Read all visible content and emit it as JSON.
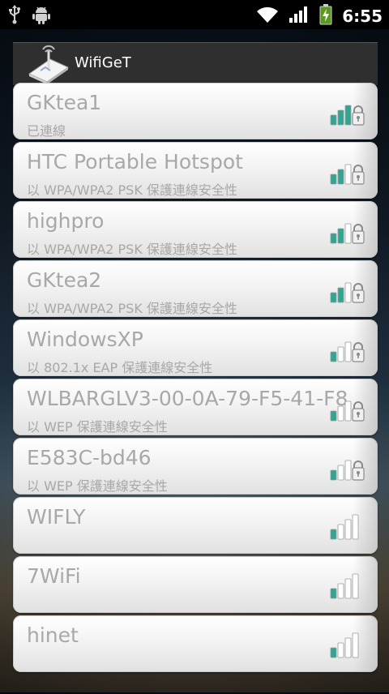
{
  "status_bar": {
    "time": "6:55",
    "icons": [
      "usb-icon",
      "android-debug-icon",
      "wifi-icon",
      "cell-signal-icon",
      "battery-charging-icon"
    ]
  },
  "app": {
    "title": "WifiGeT",
    "logo_icon": "wifi-router-icon"
  },
  "networks": [
    {
      "ssid": "GKtea1",
      "status": "已連線",
      "secured": true,
      "signal_bars": 3
    },
    {
      "ssid": "HTC Portable Hotspot",
      "status": "以 WPA/WPA2 PSK 保護連線安全性",
      "secured": true,
      "signal_bars": 2
    },
    {
      "ssid": "highpro",
      "status": "以 WPA/WPA2 PSK 保護連線安全性",
      "secured": true,
      "signal_bars": 2
    },
    {
      "ssid": "GKtea2",
      "status": "以 WPA/WPA2 PSK 保護連線安全性",
      "secured": true,
      "signal_bars": 2
    },
    {
      "ssid": "WindowsXP",
      "status": "以 802.1x EAP 保護連線安全性",
      "secured": true,
      "signal_bars": 1
    },
    {
      "ssid": "WLBARGLV3-00-0A-79-F5-41-F8",
      "status": "以 WEP 保護連線安全性",
      "secured": true,
      "signal_bars": 1
    },
    {
      "ssid": "E583C-bd46",
      "status": "以 WEP 保護連線安全性",
      "secured": true,
      "signal_bars": 1
    },
    {
      "ssid": "WIFLY",
      "status": "",
      "secured": false,
      "signal_bars": 1
    },
    {
      "ssid": "7WiFi",
      "status": "",
      "secured": false,
      "signal_bars": 1
    },
    {
      "ssid": "hinet",
      "status": "",
      "secured": false,
      "signal_bars": 1
    }
  ],
  "colors": {
    "signal_active": "#2fa592",
    "signal_inactive": "#ffffff",
    "signal_outline": "#9a9a9a",
    "title_bar": "#2f2f2f"
  }
}
